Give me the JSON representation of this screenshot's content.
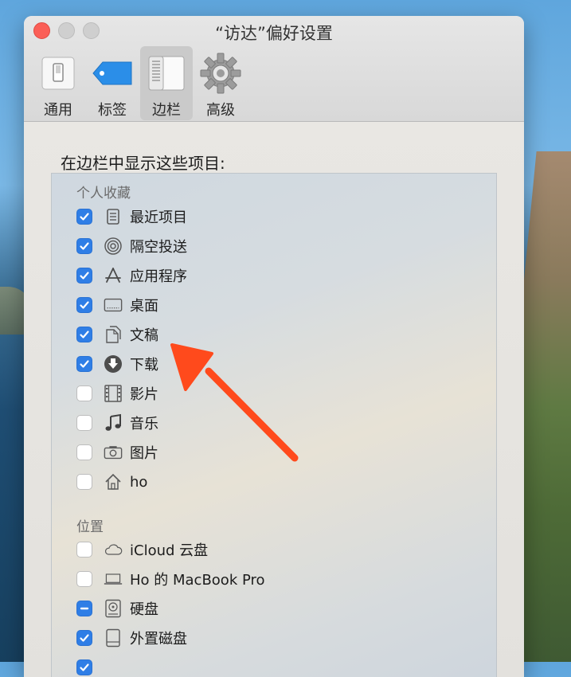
{
  "window": {
    "title": "“访达”偏好设置"
  },
  "toolbar": {
    "tabs": [
      {
        "label": "通用",
        "icon": "switch-icon",
        "active": false
      },
      {
        "label": "标签",
        "icon": "tag-icon",
        "active": false
      },
      {
        "label": "边栏",
        "icon": "sidebar-icon",
        "active": true
      },
      {
        "label": "高级",
        "icon": "gear-icon",
        "active": false
      }
    ]
  },
  "content": {
    "heading": "在边栏中显示这些项目:",
    "favorites": {
      "label": "个人收藏",
      "items": [
        {
          "label": "最近项目",
          "icon": "recents-icon",
          "state": "checked"
        },
        {
          "label": "隔空投送",
          "icon": "airdrop-icon",
          "state": "checked"
        },
        {
          "label": "应用程序",
          "icon": "applications-icon",
          "state": "checked"
        },
        {
          "label": "桌面",
          "icon": "desktop-icon",
          "state": "checked"
        },
        {
          "label": "文稿",
          "icon": "documents-icon",
          "state": "checked"
        },
        {
          "label": "下载",
          "icon": "downloads-icon",
          "state": "checked"
        },
        {
          "label": "影片",
          "icon": "movies-icon",
          "state": "unchecked"
        },
        {
          "label": "音乐",
          "icon": "music-icon",
          "state": "unchecked"
        },
        {
          "label": "图片",
          "icon": "pictures-icon",
          "state": "unchecked"
        },
        {
          "label": "ho",
          "icon": "home-icon",
          "state": "unchecked"
        }
      ]
    },
    "locations": {
      "label": "位置",
      "items": [
        {
          "label": "iCloud 云盘",
          "icon": "icloud-icon",
          "state": "unchecked"
        },
        {
          "label": "Ho 的 MacBook Pro",
          "icon": "laptop-icon",
          "state": "unchecked"
        },
        {
          "label": "硬盘",
          "icon": "harddisk-icon",
          "state": "mixed"
        },
        {
          "label": "外置磁盘",
          "icon": "external-disk-icon",
          "state": "checked"
        }
      ]
    }
  },
  "colors": {
    "accent": "#2f7ee6",
    "annotation_arrow": "#ff4a1c",
    "close_button": "#fb5f57"
  }
}
